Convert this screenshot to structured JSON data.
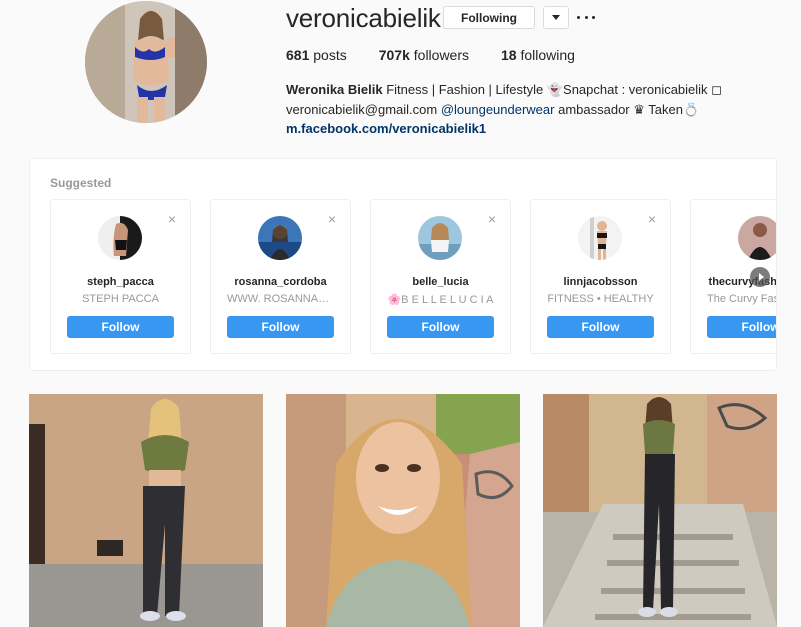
{
  "profile": {
    "username": "veronicabielik",
    "following_label": "Following",
    "stats": {
      "posts_count": "681",
      "posts_label": " posts",
      "followers_count": "707k",
      "followers_label": " followers",
      "following_count": "18",
      "following_label": " following"
    },
    "bio": {
      "full_name": "Weronika Bielik",
      "line1_text": " Fitness | Fashion | Lifestyle 👻Snapchat : veronicabielik ◻",
      "email": "veronicabielik@gmail.com ",
      "mention": "@loungeunderwear",
      "line2_text": " ambassador ♛ Taken💍",
      "website": "m.facebook.com/veronicabielik1"
    }
  },
  "suggested": {
    "title": "Suggested",
    "close_glyph": "×",
    "cards": [
      {
        "username": "steph_pacca",
        "subtitle": "STEPH PACCA",
        "button": "Follow"
      },
      {
        "username": "rosanna_cordoba",
        "subtitle": "WWW. ROSANNACORDOBA",
        "button": "Follow"
      },
      {
        "username": "belle_lucia",
        "subtitle": "🌸B E L L E L U C I A",
        "button": "Follow"
      },
      {
        "username": "linnjacobsson",
        "subtitle": "FITNESS • HEALTHY",
        "button": "Follow"
      },
      {
        "username": "thecurvyfashionista",
        "subtitle": "The Curvy Fashionista",
        "button": "Follow"
      }
    ]
  },
  "colors": {
    "follow_blue": "#3897f0",
    "link_dark_blue": "#003569",
    "muted_gray": "#999999",
    "border": "#efefef",
    "background": "#fafafa"
  },
  "icons": {
    "dropdown": "chevron-down-icon",
    "more": "more-options-icon",
    "close": "close-icon",
    "next": "chevron-right-icon"
  }
}
